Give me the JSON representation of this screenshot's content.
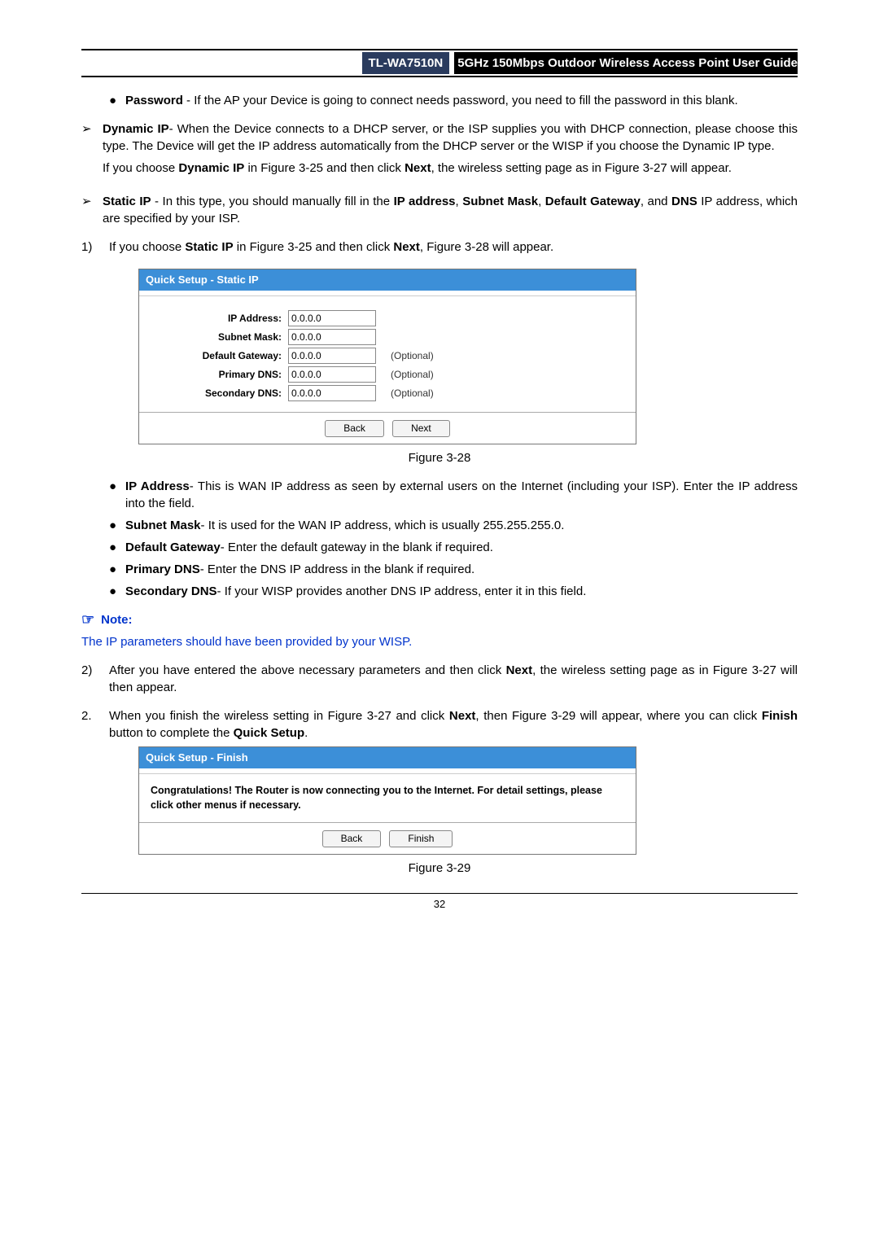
{
  "header": {
    "model": "TL-WA7510N",
    "title": "5GHz 150Mbps Outdoor Wireless Access Point User Guide"
  },
  "password_bullet": {
    "lead": "Password",
    "rest": " - If the AP your Device is going to connect needs password, you need to fill the password in this blank."
  },
  "dynamic_ip": {
    "lead": "Dynamic IP",
    "rest1": "- When the Device connects to a DHCP server, or the ISP supplies you with DHCP connection, please choose this type. The Device will get the IP address automatically from the DHCP server or the WISP if you choose the Dynamic IP type.",
    "rest2a": "If you choose ",
    "rest2b": "Dynamic IP",
    "rest2c": " in Figure 3-25 and then click ",
    "rest2d": "Next",
    "rest2e": ", the wireless setting page as in Figure 3-27 will appear."
  },
  "static_ip": {
    "lead": "Static IP",
    "rest_a": " - In this type, you should manually fill in the ",
    "rest_b": "IP address",
    "rest_c": ", ",
    "rest_d": "Subnet Mask",
    "rest_e": ", ",
    "rest_f": "Default Gateway",
    "rest_g": ", and ",
    "rest_h": "DNS",
    "rest_i": " IP address, which are specified by your ISP."
  },
  "step1": {
    "a": "If you choose ",
    "b": "Static IP",
    "c": " in Figure 3-25 and then click ",
    "d": "Next",
    "e": ", Figure 3-28 will appear."
  },
  "figure28": {
    "title": "Quick Setup - Static IP",
    "rows": {
      "ip_label": "IP Address:",
      "ip_value": "0.0.0.0",
      "sm_label": "Subnet Mask:",
      "sm_value": "0.0.0.0",
      "gw_label": "Default Gateway:",
      "gw_value": "0.0.0.0",
      "gw_opt": "(Optional)",
      "pd_label": "Primary DNS:",
      "pd_value": "0.0.0.0",
      "pd_opt": "(Optional)",
      "sd_label": "Secondary DNS:",
      "sd_value": "0.0.0.0",
      "sd_opt": "(Optional)"
    },
    "back": "Back",
    "next": "Next",
    "caption": "Figure 3-28"
  },
  "defs": {
    "ip_b": "IP Address",
    "ip_r": "- This is WAN IP address as seen by external users on the Internet (including your ISP). Enter the IP address into the field.",
    "sm_b": "Subnet Mask",
    "sm_r": "- It is used for the WAN IP address, which is usually 255.255.255.0.",
    "gw_b": "Default Gateway",
    "gw_r": "- Enter the default gateway in the blank if required.",
    "pd_b": "Primary DNS",
    "pd_r": "- Enter the DNS IP address in the blank if required.",
    "sd_b": "Secondary DNS",
    "sd_r": "- If your WISP provides another DNS IP address, enter it in this field."
  },
  "note": {
    "label": "Note:",
    "text": "The IP parameters should have been provided by your WISP."
  },
  "step2a": {
    "a": "After you have entered the above necessary parameters and then click ",
    "b": "Next",
    "c": ", the wireless setting page as in Figure 3-27 will then appear."
  },
  "step_outer2": {
    "a": "When you finish the wireless setting in Figure 3-27 and click ",
    "b": "Next",
    "c": ", then Figure 3-29 will appear, where you can click ",
    "d": "Finish",
    "e": " button to complete the ",
    "f": "Quick Setup",
    "g": "."
  },
  "figure29": {
    "title": "Quick Setup - Finish",
    "body": "Congratulations! The Router is now connecting you to the Internet. For detail settings, please click other menus if necessary.",
    "back": "Back",
    "finish": "Finish",
    "caption": "Figure 3-29"
  },
  "page_number": "32"
}
